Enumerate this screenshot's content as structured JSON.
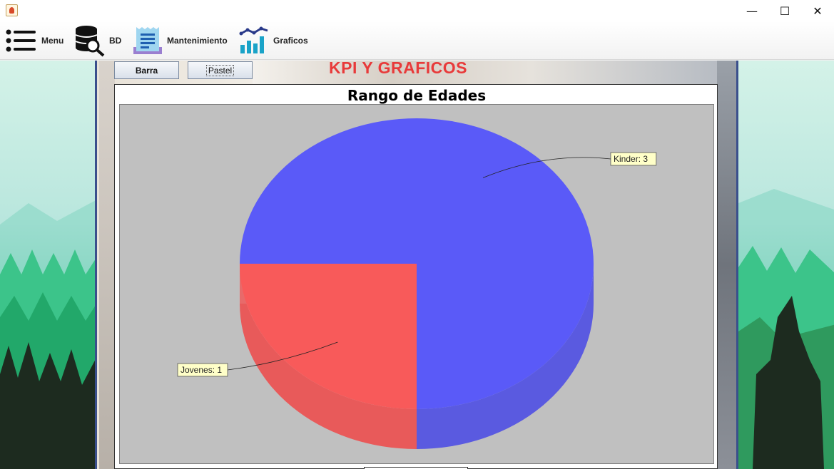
{
  "window": {
    "minimize": "—",
    "maximize": "☐",
    "close": "✕"
  },
  "menubar": {
    "items": [
      {
        "label": "Menu",
        "icon": "list-icon"
      },
      {
        "label": "BD",
        "icon": "database-search-icon"
      },
      {
        "label": "Mantenimiento",
        "icon": "document-icon"
      },
      {
        "label": "Graficos",
        "icon": "chart-icon"
      }
    ]
  },
  "toolbar": {
    "barra_label": "Barra",
    "pastel_label": "Pastel"
  },
  "page": {
    "kpi_title": "KPI  Y GRAFICOS"
  },
  "colors": {
    "kinder": "#5a5af8",
    "jovenes": "#f85a5a",
    "kpi_title": "#e83a3a",
    "plot_bg": "#c0c0c0"
  },
  "chart_data": {
    "type": "pie",
    "title": "Rango de Edades",
    "slices": [
      {
        "label": "Kinder",
        "value": 3,
        "tooltip": "Kinder: 3"
      },
      {
        "label": "Jovenes",
        "value": 1,
        "tooltip": "Jovenes: 1"
      }
    ],
    "style": "3d"
  }
}
